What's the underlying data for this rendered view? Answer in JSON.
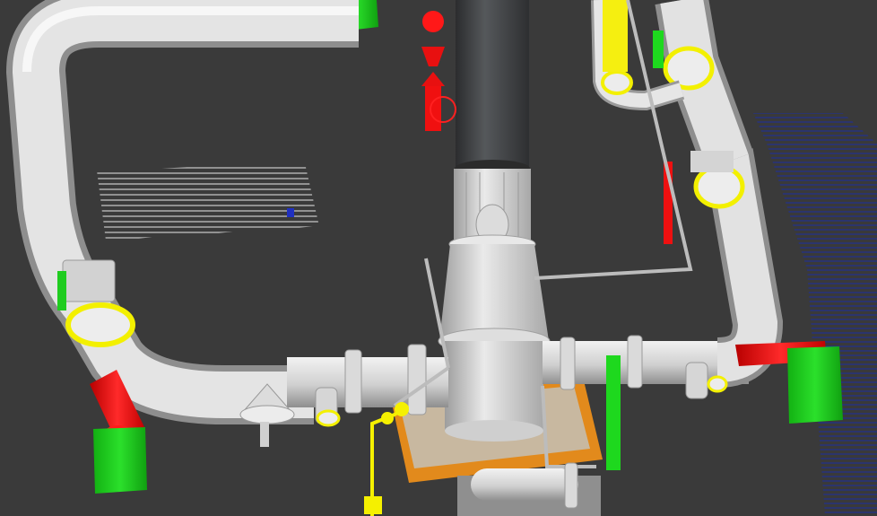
{
  "window": {
    "title": ""
  },
  "scene": {
    "description_label": "",
    "colors": {
      "background": "#3a3a3a",
      "pipe_light": "#e6e6e6",
      "pipe_mid": "#b8b8b8",
      "pipe_shadow": "#8a8a8a",
      "stack_dark": "#3d3f41",
      "support_green": "#16d616",
      "highlight_red": "#f01010",
      "highlight_yellow": "#f5f000",
      "base_orange": "#e08a1a",
      "hatch_white": "#e0e0e0",
      "hatch_blue": "#1a2a9a"
    },
    "objects": [
      {
        "name": "overhead-pipe-loop",
        "type": "pipe",
        "color": "pipe_light"
      },
      {
        "name": "central-stack",
        "type": "vertical-pipe",
        "color": "stack_dark"
      },
      {
        "name": "cone-reducer",
        "type": "reducer",
        "color": "pipe_light"
      },
      {
        "name": "lower-header-pipe",
        "type": "pipe",
        "color": "pipe_light"
      },
      {
        "name": "right-vertical-pipe",
        "type": "pipe",
        "color": "pipe_light"
      },
      {
        "name": "left-red-pipe-end",
        "type": "pipe-end",
        "color": "highlight_red"
      },
      {
        "name": "right-red-pipe-end",
        "type": "pipe-end",
        "color": "highlight_red"
      },
      {
        "name": "green-support-left",
        "type": "support",
        "color": "support_green"
      },
      {
        "name": "green-support-right",
        "type": "support",
        "color": "support_green"
      },
      {
        "name": "orange-base-plate",
        "type": "foundation",
        "color": "base_orange"
      },
      {
        "name": "red-valve-assembly",
        "type": "valve",
        "color": "highlight_red"
      },
      {
        "name": "yellow-instrument-line",
        "type": "instrument",
        "color": "highlight_yellow"
      },
      {
        "name": "white-hatch-region",
        "type": "annotation-hatch",
        "color": "hatch_white"
      },
      {
        "name": "blue-hatch-region",
        "type": "annotation-hatch",
        "color": "hatch_blue"
      }
    ]
  }
}
